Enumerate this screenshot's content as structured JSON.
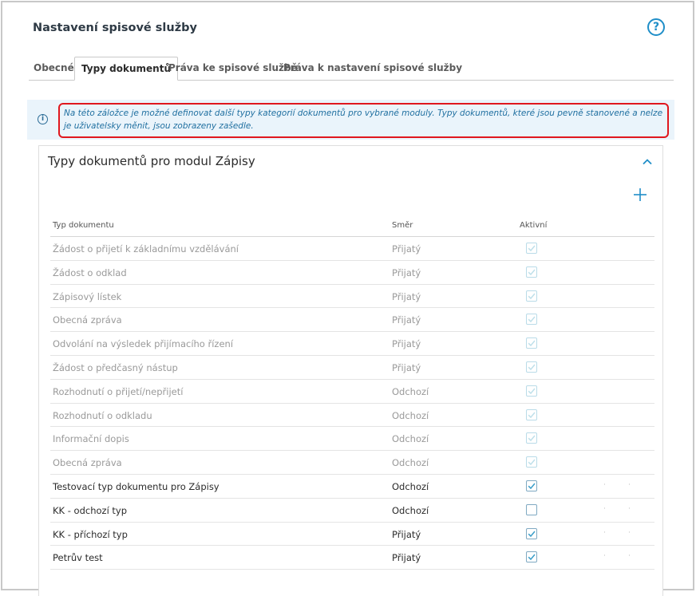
{
  "page": {
    "title": "Nastavení spisové služby",
    "help_glyph": "?"
  },
  "tabs": [
    {
      "label": "Obecné"
    },
    {
      "label": "Typy dokumentů"
    },
    {
      "label": "Práva ke spisové službě"
    },
    {
      "label": "Práva k nastavení spisové služby"
    }
  ],
  "active_tab_index": 1,
  "info": {
    "icon_glyph": "i",
    "text": "Na této záložce je možné definovat další typy kategorií dokumentů pro vybrané moduly. Typy dokumentů, které jsou pevně stanovené a nelze je uživatelsky měnit, jsou zobrazeny zašedle."
  },
  "panel": {
    "title": "Typy dokumentů pro modul Zápisy"
  },
  "table": {
    "headers": {
      "type": "Typ dokumentu",
      "direction": "Směr",
      "active": "Aktivní"
    },
    "rows": [
      {
        "type": "Žádost o přijetí k základnímu vzdělávání",
        "direction": "Přijatý",
        "active": true,
        "locked": true
      },
      {
        "type": "Žádost o odklad",
        "direction": "Přijatý",
        "active": true,
        "locked": true
      },
      {
        "type": "Zápisový lístek",
        "direction": "Přijatý",
        "active": true,
        "locked": true
      },
      {
        "type": "Obecná zpráva",
        "direction": "Přijatý",
        "active": true,
        "locked": true
      },
      {
        "type": "Odvolání na výsledek přijímacího řízení",
        "direction": "Přijatý",
        "active": true,
        "locked": true
      },
      {
        "type": "Žádost o předčasný nástup",
        "direction": "Přijatý",
        "active": true,
        "locked": true
      },
      {
        "type": "Rozhodnutí o přijetí/nepřijetí",
        "direction": "Odchozí",
        "active": true,
        "locked": true
      },
      {
        "type": "Rozhodnutí o odkladu",
        "direction": "Odchozí",
        "active": true,
        "locked": true
      },
      {
        "type": "Informační dopis",
        "direction": "Odchozí",
        "active": true,
        "locked": true
      },
      {
        "type": "Obecná zpráva",
        "direction": "Odchozí",
        "active": true,
        "locked": true
      },
      {
        "type": "Testovací typ dokumentu pro Zápisy",
        "direction": "Odchozí",
        "active": true,
        "locked": false
      },
      {
        "type": "KK - odchozí typ",
        "direction": "Odchozí",
        "active": false,
        "locked": false
      },
      {
        "type": "KK - příchozí typ",
        "direction": "Přijatý",
        "active": true,
        "locked": false
      },
      {
        "type": "Petrův test",
        "direction": "Přijatý",
        "active": true,
        "locked": false
      }
    ]
  },
  "colors": {
    "accent": "#1f8ec8",
    "highlight_border": "#e0171e",
    "info_bg": "#eaf4fb",
    "locked_text": "#9a9a9a"
  }
}
